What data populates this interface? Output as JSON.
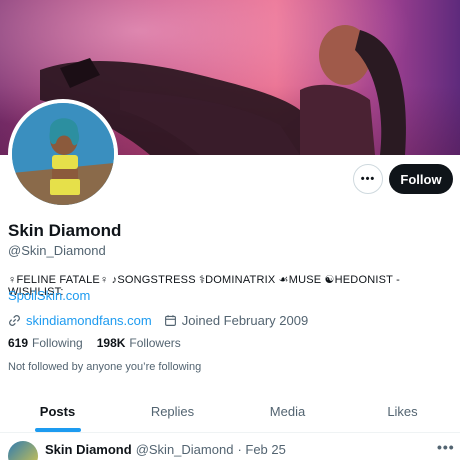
{
  "profile": {
    "display_name": "Skin Diamond",
    "handle": "@Skin_Diamond",
    "bio": "♀FELINE FATALE♀ ♪SONGSTRESS ⚕DOMINATRIX ☙MUSE ☯HEDONIST - WISHLIST:",
    "bio_link": "SpoilSkin.com",
    "website": "skindiamondfans.com",
    "joined": "Joined February 2009",
    "following_count": "619",
    "following_label": "Following",
    "followers_count": "198K",
    "followers_label": "Followers",
    "not_followed_text": "Not followed by anyone you’re following"
  },
  "actions": {
    "more_label": "•••",
    "follow_label": "Follow"
  },
  "tabs": [
    {
      "label": "Posts",
      "active": true
    },
    {
      "label": "Replies",
      "active": false
    },
    {
      "label": "Media",
      "active": false
    },
    {
      "label": "Likes",
      "active": false
    }
  ],
  "post": {
    "author": "Skin Diamond",
    "handle": "@Skin_Diamond",
    "date": "· Feb 25",
    "more_label": "•••"
  },
  "icons": {
    "link": "link-icon",
    "calendar": "calendar-icon"
  },
  "colors": {
    "accent": "#1d9bf0",
    "follow_button": "#0f1419",
    "secondary_text": "#536471"
  }
}
